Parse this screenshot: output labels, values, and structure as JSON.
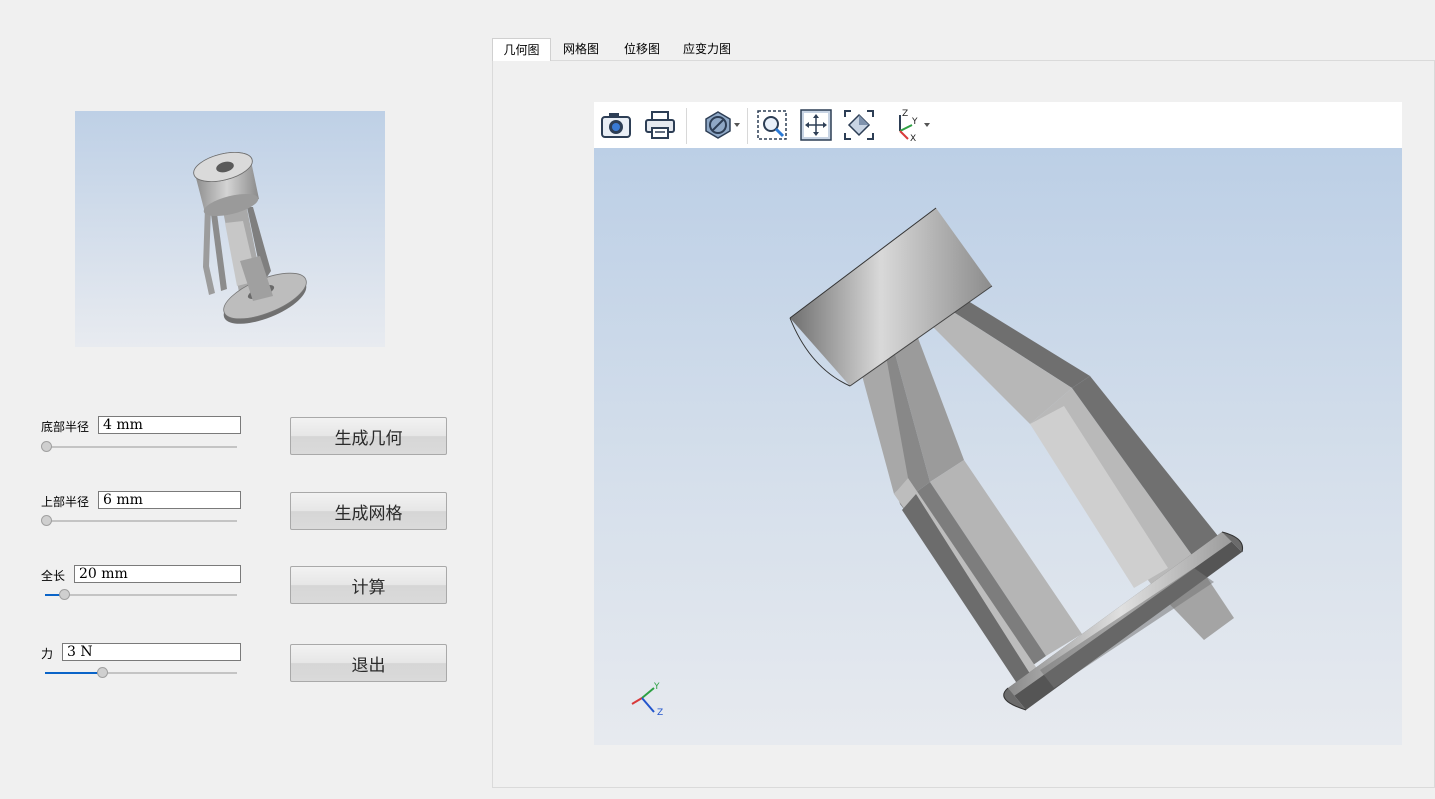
{
  "params": [
    {
      "label": "底部半径",
      "value": "4 mm",
      "slider": 0.0
    },
    {
      "label": "上部半径",
      "value": "6 mm",
      "slider": 0.0
    },
    {
      "label": "全长",
      "value": "20 mm",
      "slider": 0.1
    },
    {
      "label": "力",
      "value": "3 N",
      "slider": 0.3
    }
  ],
  "buttons": {
    "generate_geometry": "生成几何",
    "generate_mesh": "生成网格",
    "compute": "计算",
    "exit": "退出"
  },
  "tabs": [
    {
      "label": "几何图",
      "active": true
    },
    {
      "label": "网格图",
      "active": false
    },
    {
      "label": "位移图",
      "active": false
    },
    {
      "label": "应变力图",
      "active": false
    }
  ],
  "toolbar": {
    "icons": [
      "camera-icon",
      "print-icon",
      "display-mode-icon",
      "zoom-box-icon",
      "pan-icon",
      "fit-all-icon",
      "axis-view-icon"
    ]
  },
  "triad": {
    "x": "X",
    "y": "Y",
    "z": "Z"
  },
  "colors": {
    "accent": "#0a64c8",
    "viewport_top": "#bccfe6",
    "viewport_bottom": "#e7eaef",
    "model_grey": "#a6a6a6"
  }
}
